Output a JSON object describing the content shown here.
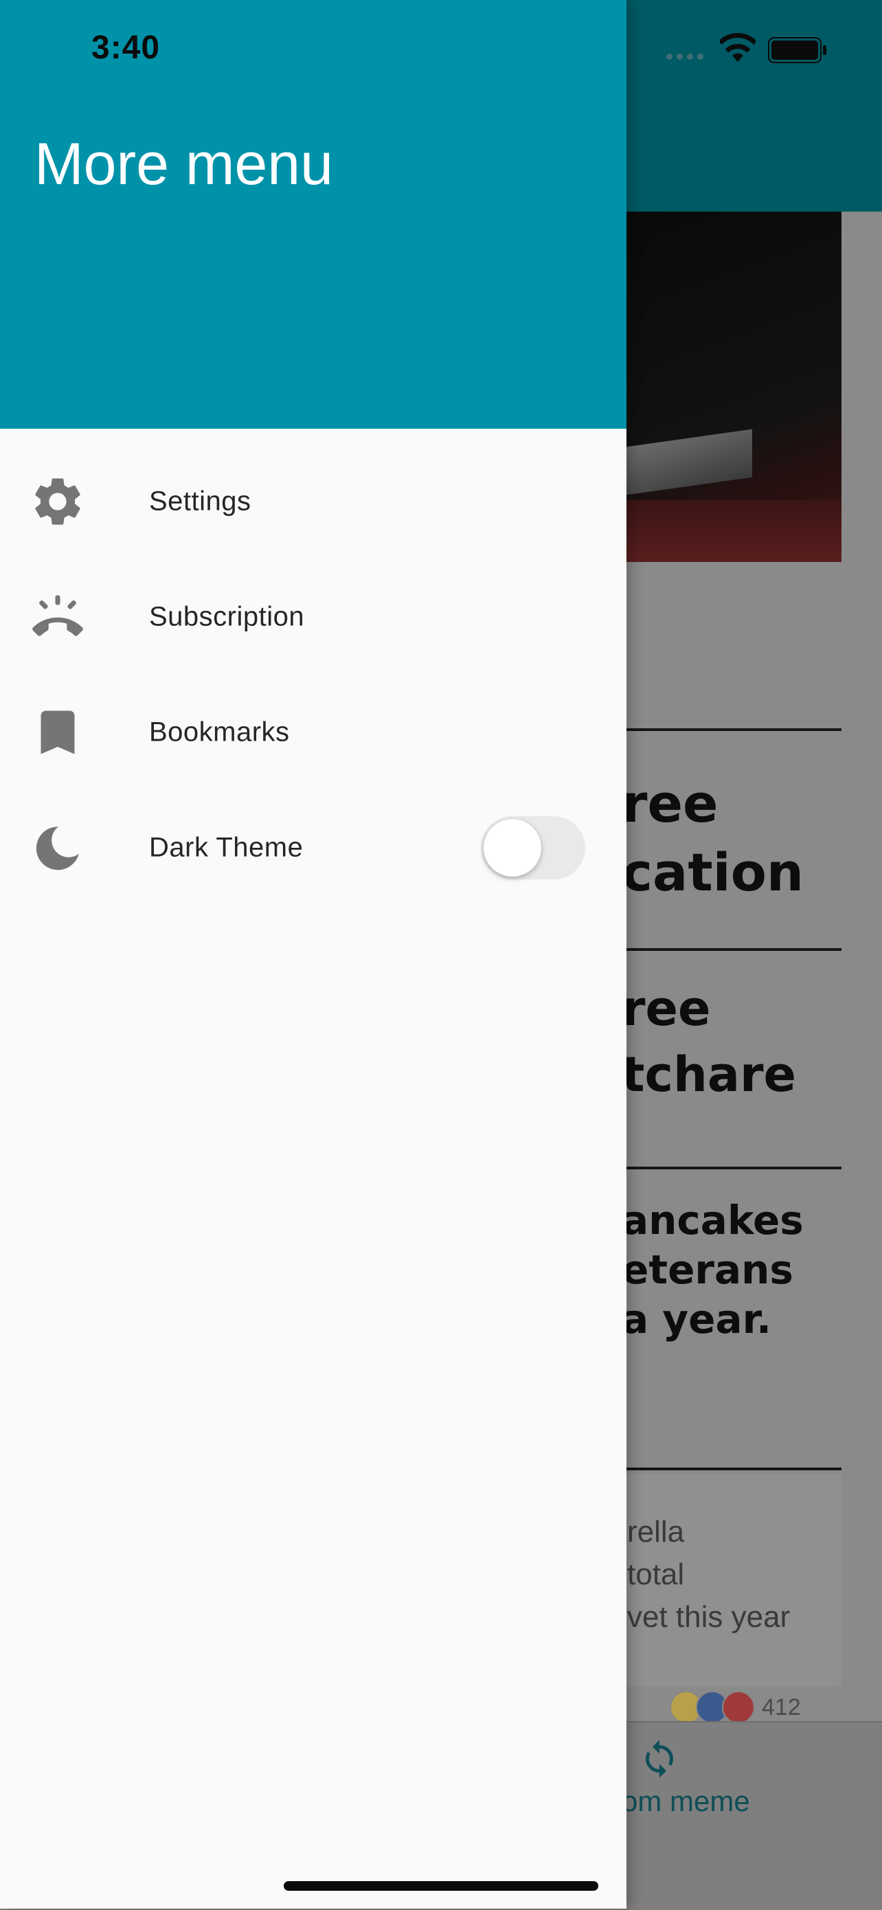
{
  "status_bar": {
    "time": "3:40"
  },
  "drawer": {
    "title": "More menu",
    "header_color": "#0092a9",
    "items": [
      {
        "label": "Settings",
        "icon": "gear-icon"
      },
      {
        "label": "Subscription",
        "icon": "subscription-icon"
      },
      {
        "label": "Bookmarks",
        "icon": "bookmark-icon"
      },
      {
        "label": "Dark Theme",
        "icon": "moon-icon",
        "toggle": false
      }
    ]
  },
  "background": {
    "meme_text_lines": [
      "ree",
      "cation",
      "ree",
      "tchare",
      "ancakes",
      "eterans",
      "a year."
    ],
    "comment_lines": [
      "rella",
      "total",
      "vet this year"
    ],
    "reaction_count": "412",
    "bottom_button_label": "om meme"
  }
}
